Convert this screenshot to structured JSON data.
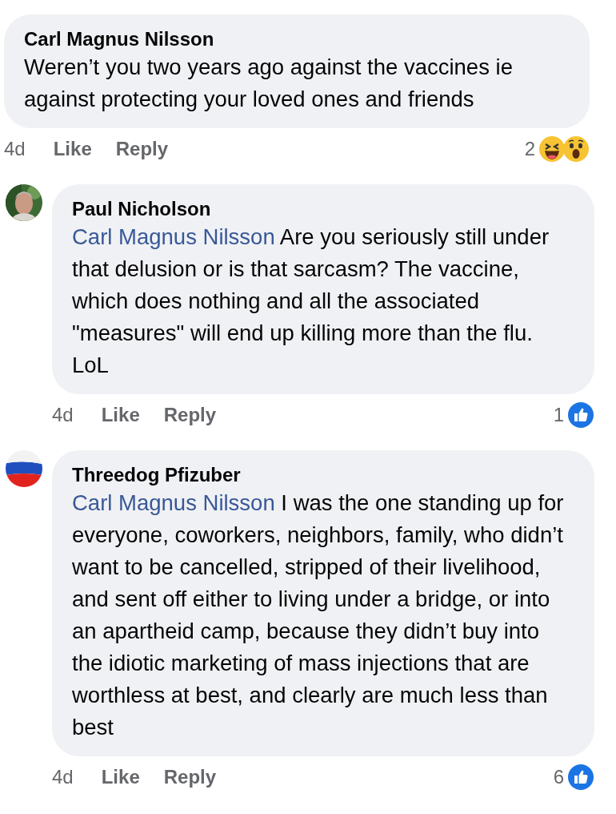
{
  "comments": [
    {
      "author": "Carl Magnus Nilsson",
      "text": "Weren’t you two years ago against the vaccines ie against protecting your loved ones and friends",
      "time": "4d",
      "like": "Like",
      "reply": "Reply",
      "reaction_count": "2",
      "reactions": [
        {
          "kind": "haha"
        },
        {
          "kind": "wow"
        }
      ]
    },
    {
      "author": "Paul Nicholson",
      "avatar": {
        "kind": "picture"
      },
      "mention": "Carl Magnus Nilsson",
      "text": "Are you seriously still under that delusion or is that sarcasm? The vaccine, which does nothing and all the associated \"measures\" will end up killing more than the flu. LoL",
      "time": "4d",
      "like": "Like",
      "reply": "Reply",
      "reaction_count": "1",
      "reactions": [
        {
          "kind": "like"
        }
      ]
    },
    {
      "author": "Threedog Pfizuber",
      "avatar": {
        "kind": "picture"
      },
      "mention": "Carl Magnus Nilsson",
      "text": "I was the one standing up for everyone, coworkers, neighbors, family, who didn’t want to be cancelled, stripped of their livelihood, and sent off either to living under a bridge, or into an apartheid camp, because they didn’t buy into the idiotic marketing of mass injections that are worthless at best, and clearly are much less than best",
      "time": "4d",
      "like": "Like",
      "reply": "Reply",
      "reaction_count": "6",
      "reactions": [
        {
          "kind": "like"
        }
      ]
    }
  ]
}
